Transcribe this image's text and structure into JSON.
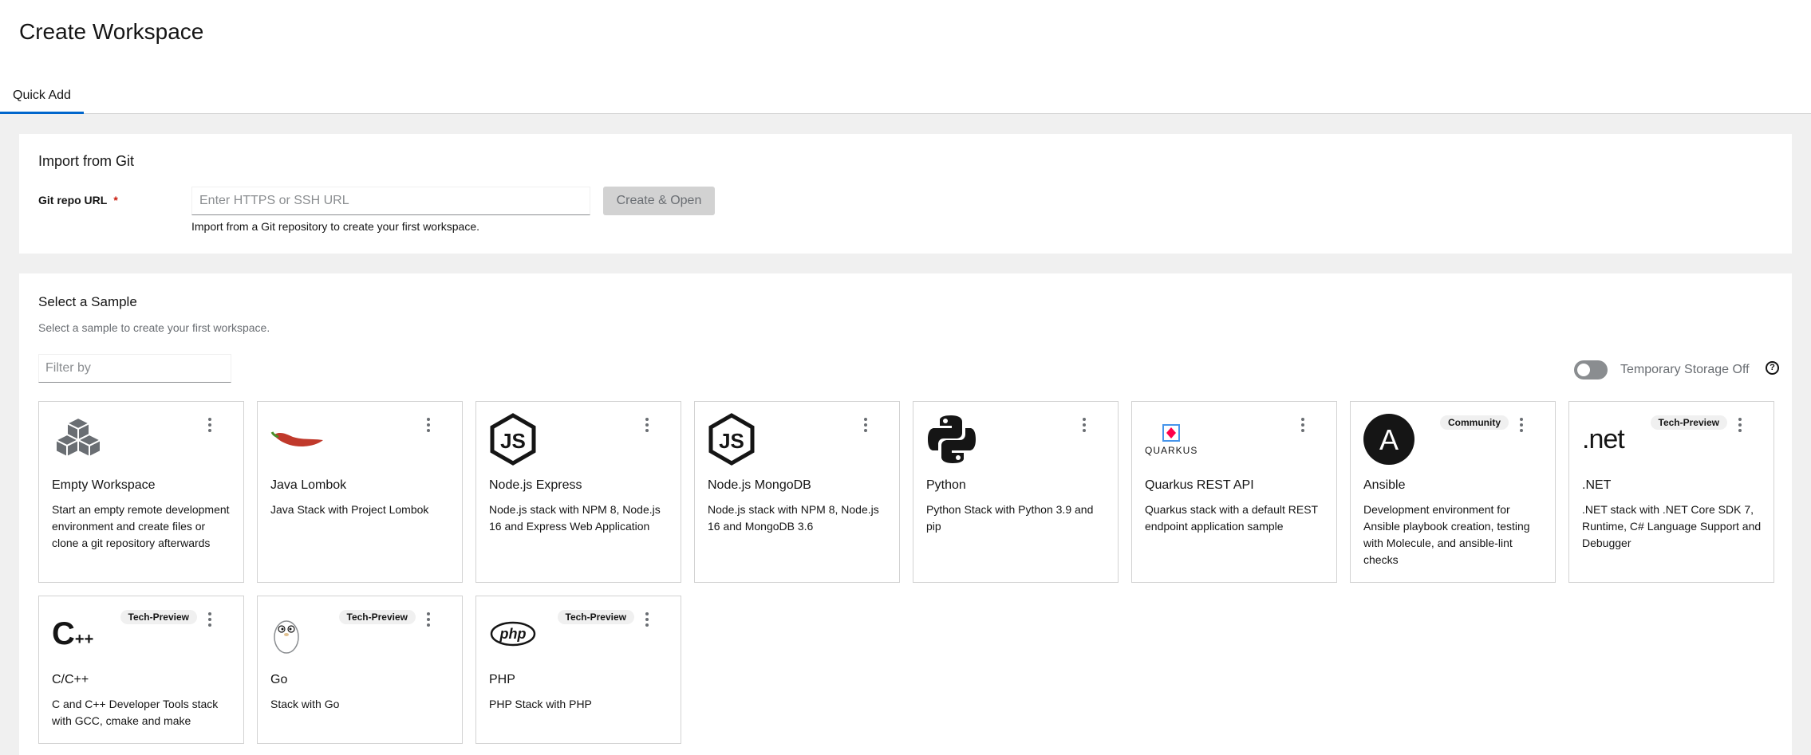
{
  "page_title": "Create Workspace",
  "tabs": [
    {
      "label": "Quick Add"
    }
  ],
  "git": {
    "title": "Import from Git",
    "label": "Git repo URL",
    "required": "*",
    "placeholder": "Enter HTTPS or SSH URL",
    "button": "Create & Open",
    "helper": "Import from a Git repository to create your first workspace."
  },
  "samples": {
    "title": "Select a Sample",
    "subtitle": "Select a sample to create your first workspace.",
    "filter_placeholder": "Filter by",
    "toggle_label": "Temporary Storage Off",
    "help_icon": "?",
    "cards": [
      {
        "title": "Empty Workspace",
        "desc": "Start an empty remote development environment and create files or clone a git repository afterwards",
        "badge": "",
        "icon": "cubes-icon"
      },
      {
        "title": "Java Lombok",
        "desc": "Java Stack with Project Lombok",
        "badge": "",
        "icon": "chili-pepper-icon"
      },
      {
        "title": "Node.js Express",
        "desc": "Node.js stack with NPM 8, Node.js 16 and Express Web Application",
        "badge": "",
        "icon": "nodejs-icon"
      },
      {
        "title": "Node.js MongoDB",
        "desc": "Node.js stack with NPM 8, Node.js 16 and MongoDB 3.6",
        "badge": "",
        "icon": "nodejs-icon"
      },
      {
        "title": "Python",
        "desc": "Python Stack with Python 3.9 and pip",
        "badge": "",
        "icon": "python-icon"
      },
      {
        "title": "Quarkus REST API",
        "desc": "Quarkus stack with a default REST endpoint application sample",
        "badge": "",
        "icon": "quarkus-icon",
        "icon_text": "QUARKUS"
      },
      {
        "title": "Ansible",
        "desc": "Development environment for Ansible playbook creation, testing with Molecule, and ansible-lint checks",
        "badge": "Community",
        "icon": "ansible-icon",
        "icon_text": "A"
      },
      {
        "title": ".NET",
        "desc": ".NET stack with .NET Core SDK 7, Runtime, C# Language Support and Debugger",
        "badge": "Tech-Preview",
        "icon": "dotnet-icon",
        "icon_text": ".net"
      },
      {
        "title": "C/C++",
        "desc": "C and C++ Developer Tools stack with GCC, cmake and make",
        "badge": "Tech-Preview",
        "icon": "cpp-icon",
        "icon_text": "C++"
      },
      {
        "title": "Go",
        "desc": "Stack with Go",
        "badge": "Tech-Preview",
        "icon": "gopher-icon"
      },
      {
        "title": "PHP",
        "desc": "PHP Stack with PHP",
        "badge": "Tech-Preview",
        "icon": "php-icon",
        "icon_text": "php"
      }
    ]
  }
}
